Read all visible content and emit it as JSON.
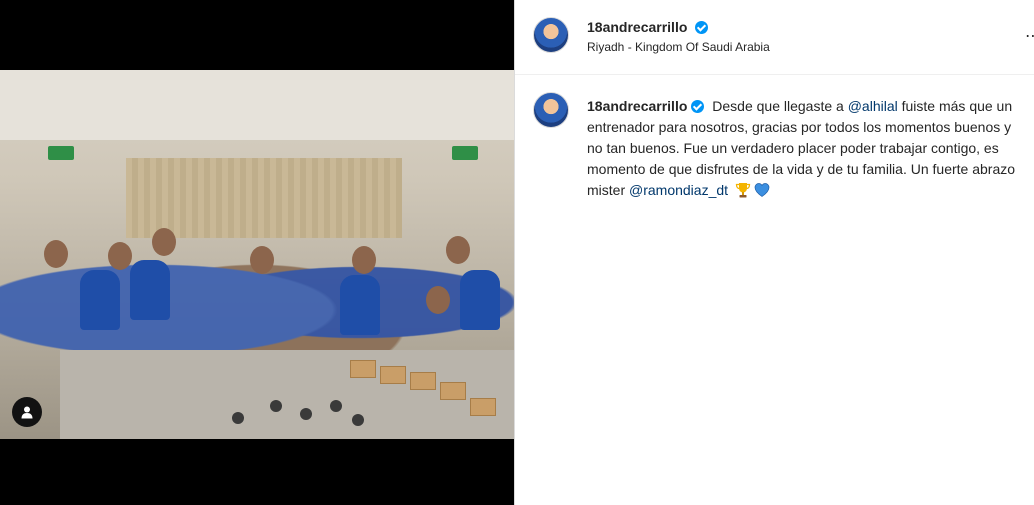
{
  "post": {
    "username": "18andrecarrillo",
    "location": "Riyadh - Kingdom Of Saudi Arabia",
    "more_icon": "more-options-icon",
    "verified_icon": "verified-badge-icon"
  },
  "caption": {
    "username": "18andrecarrillo",
    "text_1": "Desde que llegaste a ",
    "mention_1": "@alhilal",
    "text_2": " fuiste más que un entrenador para nosotros, gracias por todos los momentos buenos y no tan buenos. Fue un verdadero placer poder trabajar contigo, es momento de que disfrutes de la vida y de tu familia. Un fuerte abrazo mister ",
    "mention_2": "@ramondiaz_dt",
    "emojis": [
      "trophy-icon",
      "blue-heart-icon"
    ]
  },
  "media": {
    "tagged_icon": "user-tag-icon"
  },
  "colors": {
    "verified": "#0095f6",
    "mention": "#00376b",
    "border": "#dbdbdb"
  }
}
